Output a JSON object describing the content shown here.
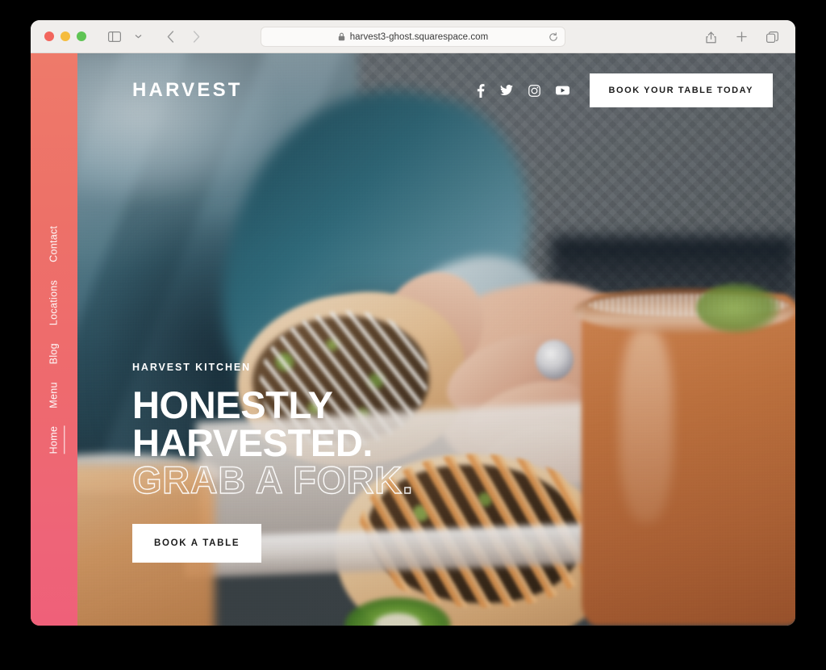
{
  "browser": {
    "traffic_lights": [
      "close",
      "minimize",
      "maximize"
    ],
    "sidebar_toggle_icon": "sidebar-icon",
    "sidebar_dropdown_icon": "chevron-down-icon",
    "back_icon": "chevron-left-icon",
    "forward_icon": "chevron-right-icon",
    "url": "harvest3-ghost.squarespace.com",
    "lock_icon": "lock-icon",
    "reload_icon": "reload-icon",
    "share_icon": "share-icon",
    "new_tab_icon": "plus-icon",
    "tab_overview_icon": "tabs-icon"
  },
  "site": {
    "logo": "HARVEST",
    "nav": [
      {
        "label": "Home",
        "active": true
      },
      {
        "label": "Menu",
        "active": false
      },
      {
        "label": "Blog",
        "active": false
      },
      {
        "label": "Locations",
        "active": false
      },
      {
        "label": "Contact",
        "active": false
      }
    ],
    "socials": [
      {
        "name": "facebook-icon",
        "label": "Facebook"
      },
      {
        "name": "twitter-icon",
        "label": "Twitter"
      },
      {
        "name": "instagram-icon",
        "label": "Instagram"
      },
      {
        "name": "youtube-icon",
        "label": "YouTube"
      }
    ],
    "header_cta": "BOOK YOUR TABLE TODAY",
    "hero": {
      "eyebrow": "HARVEST KITCHEN",
      "line1": "HONESTLY",
      "line2": "HARVESTED.",
      "line3_outline": "GRAB A FORK.",
      "cta": "BOOK A TABLE"
    },
    "colors": {
      "rail_top": "#ee7a6a",
      "rail_bottom": "#ef6079",
      "cta_background": "#ffffff",
      "cta_text": "#1c1c1c"
    }
  }
}
